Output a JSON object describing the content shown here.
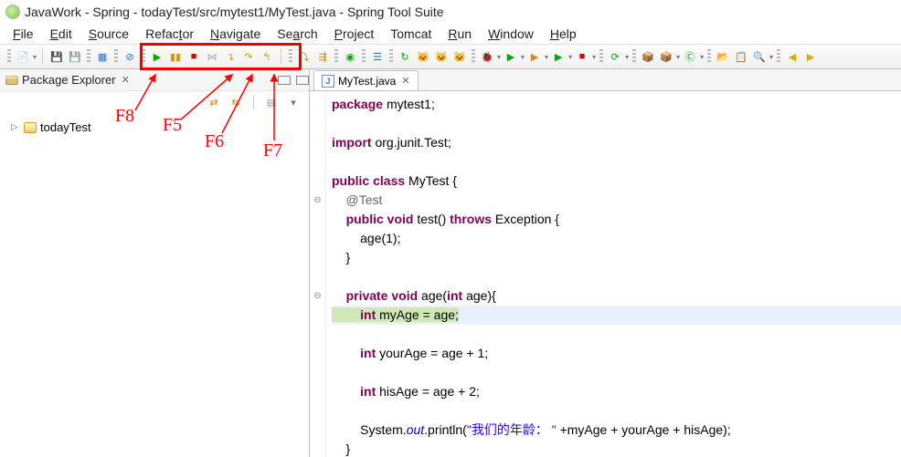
{
  "title": "JavaWork - Spring - todayTest/src/mytest1/MyTest.java - Spring Tool Suite",
  "menu": [
    "File",
    "Edit",
    "Source",
    "Refactor",
    "Navigate",
    "Search",
    "Project",
    "Tomcat",
    "Run",
    "Window",
    "Help"
  ],
  "menu_accel": [
    "F",
    "E",
    "S",
    "t",
    "N",
    "a",
    "P",
    "",
    "R",
    "W",
    "H"
  ],
  "pkg": {
    "title": "Package Explorer",
    "project": "todayTest"
  },
  "editor": {
    "tab": "MyTest.java"
  },
  "code_lines": [
    {
      "g": "",
      "segments": [
        {
          "t": "package ",
          "c": "kw"
        },
        {
          "t": "mytest1;"
        }
      ]
    },
    {
      "g": "",
      "segments": [
        {
          "t": " "
        }
      ]
    },
    {
      "g": "",
      "segments": [
        {
          "t": "import ",
          "c": "kw"
        },
        {
          "t": "org.junit.Test;"
        }
      ]
    },
    {
      "g": "",
      "segments": [
        {
          "t": " "
        }
      ]
    },
    {
      "g": "",
      "segments": [
        {
          "t": "public class ",
          "c": "kw"
        },
        {
          "t": "MyTest {"
        }
      ]
    },
    {
      "g": "⊖",
      "segments": [
        {
          "t": "    @Test",
          "c": "ann"
        }
      ]
    },
    {
      "g": "",
      "segments": [
        {
          "t": "    "
        },
        {
          "t": "public void ",
          "c": "kw"
        },
        {
          "t": "test() "
        },
        {
          "t": "throws ",
          "c": "kw"
        },
        {
          "t": "Exception {"
        }
      ]
    },
    {
      "g": "",
      "segments": [
        {
          "t": "        age(1);"
        }
      ]
    },
    {
      "g": "",
      "segments": [
        {
          "t": "    }"
        }
      ]
    },
    {
      "g": "",
      "segments": [
        {
          "t": " "
        }
      ]
    },
    {
      "g": "⊖",
      "segments": [
        {
          "t": "    "
        },
        {
          "t": "private void ",
          "c": "kw"
        },
        {
          "t": "age("
        },
        {
          "t": "int ",
          "c": "kw"
        },
        {
          "t": "age){"
        }
      ]
    },
    {
      "g": "",
      "hl": true,
      "segments": [
        {
          "t": "        ",
          "exec": true
        },
        {
          "t": "int ",
          "c": "kw",
          "exec": true
        },
        {
          "t": "myAge = age;",
          "exec": true
        }
      ]
    },
    {
      "g": "",
      "segments": [
        {
          "t": " "
        }
      ]
    },
    {
      "g": "",
      "segments": [
        {
          "t": "        "
        },
        {
          "t": "int ",
          "c": "kw"
        },
        {
          "t": "yourAge = age + 1;"
        }
      ]
    },
    {
      "g": "",
      "segments": [
        {
          "t": " "
        }
      ]
    },
    {
      "g": "",
      "segments": [
        {
          "t": "        "
        },
        {
          "t": "int ",
          "c": "kw"
        },
        {
          "t": "hisAge = age + 2;"
        }
      ]
    },
    {
      "g": "",
      "segments": [
        {
          "t": " "
        }
      ]
    },
    {
      "g": "",
      "segments": [
        {
          "t": "        System."
        },
        {
          "t": "out",
          "c": "fld"
        },
        {
          "t": ".println("
        },
        {
          "t": "\"我们的年龄： \"",
          "c": "str"
        },
        {
          "t": " +myAge + yourAge + hisAge);"
        }
      ]
    },
    {
      "g": "",
      "segments": [
        {
          "t": "    }"
        }
      ]
    }
  ],
  "annotations": {
    "f8": "F8",
    "f5": "F5",
    "f6": "F6",
    "f7": "F7"
  }
}
